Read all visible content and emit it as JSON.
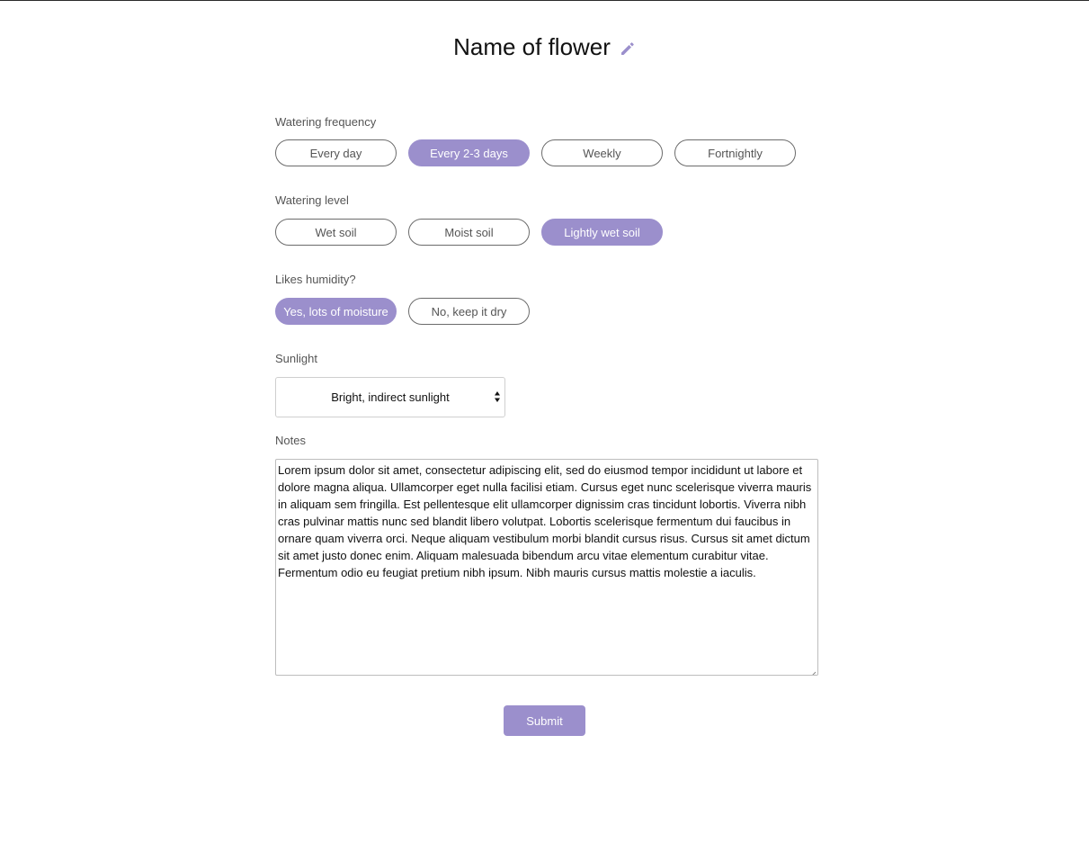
{
  "header": {
    "title": "Name of flower",
    "edit_icon": "pencil-icon"
  },
  "colors": {
    "accent": "#9b8fcc",
    "label": "#555555",
    "pill_border": "#6b6b6b"
  },
  "watering_frequency": {
    "label": "Watering frequency",
    "options": [
      "Every day",
      "Every 2-3 days",
      "Weekly",
      "Fortnightly"
    ],
    "selected": "Every 2-3 days"
  },
  "watering_level": {
    "label": "Watering level",
    "options": [
      "Wet soil",
      "Moist soil",
      "Lightly wet soil"
    ],
    "selected": "Lightly wet soil"
  },
  "humidity": {
    "label": "Likes humidity?",
    "options": [
      "Yes, lots of moisture",
      "No, keep it dry"
    ],
    "selected": "Yes, lots of moisture"
  },
  "sunlight": {
    "label": "Sunlight",
    "value": "Bright, indirect sunlight"
  },
  "notes": {
    "label": "Notes",
    "value": "Lorem ipsum dolor sit amet, consectetur adipiscing elit, sed do eiusmod tempor incididunt ut labore et dolore magna aliqua. Ullamcorper eget nulla facilisi etiam. Cursus eget nunc scelerisque viverra mauris in aliquam sem fringilla. Est pellentesque elit ullamcorper dignissim cras tincidunt lobortis. Viverra nibh cras pulvinar mattis nunc sed blandit libero volutpat. Lobortis scelerisque fermentum dui faucibus in ornare quam viverra orci. Neque aliquam vestibulum morbi blandit cursus risus. Cursus sit amet dictum sit amet justo donec enim. Aliquam malesuada bibendum arcu vitae elementum curabitur vitae. Fermentum odio eu feugiat pretium nibh ipsum. Nibh mauris cursus mattis molestie a iaculis."
  },
  "submit": {
    "label": "Submit"
  }
}
